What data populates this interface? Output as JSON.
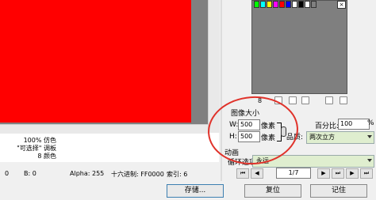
{
  "colors": {
    "canvas": "#ff0000",
    "annotation_circle": "#e0322a",
    "select_bg": "#dfeecf",
    "palette_bg": "#7f7f7f"
  },
  "info": {
    "dither": "100% 仿色",
    "palette_type": "\"可选择\" 调板",
    "color_count": "8 颜色"
  },
  "status": {
    "r_value": "0",
    "b_label": "B: 0",
    "alpha": "Alpha: 255",
    "hex": "十六进制: FF0000",
    "index": "索引: 6"
  },
  "palette": {
    "swatches": [
      "#00ff00",
      "#00ffff",
      "#ffff00",
      "#ff00ff",
      "#ff0000",
      "#0000ff",
      "#ffffff",
      "#000000",
      "#ffffff",
      "#808080"
    ],
    "close_glyph": "×",
    "count": "8"
  },
  "image_size": {
    "title": "图像大小",
    "w_label": "W:",
    "w_value": "500",
    "w_unit": "像素",
    "h_label": "H:",
    "h_value": "500",
    "h_unit": "像素",
    "quality_label": "品质:",
    "percent_label": "百分比:",
    "percent_value": "100",
    "percent_unit": "%",
    "resample": "两次立方"
  },
  "animation": {
    "title": "动画",
    "loop_label": "循环选项:",
    "loop_value": "永远",
    "frame": "1/7",
    "nav_icons": [
      "first-frame-icon",
      "prev-frame-icon",
      "next-frame-icon",
      "last-frame-icon",
      "play-icon",
      "end-frame-icon"
    ]
  },
  "buttons": {
    "save": "存储...",
    "reset": "复位",
    "remember": "记住"
  }
}
